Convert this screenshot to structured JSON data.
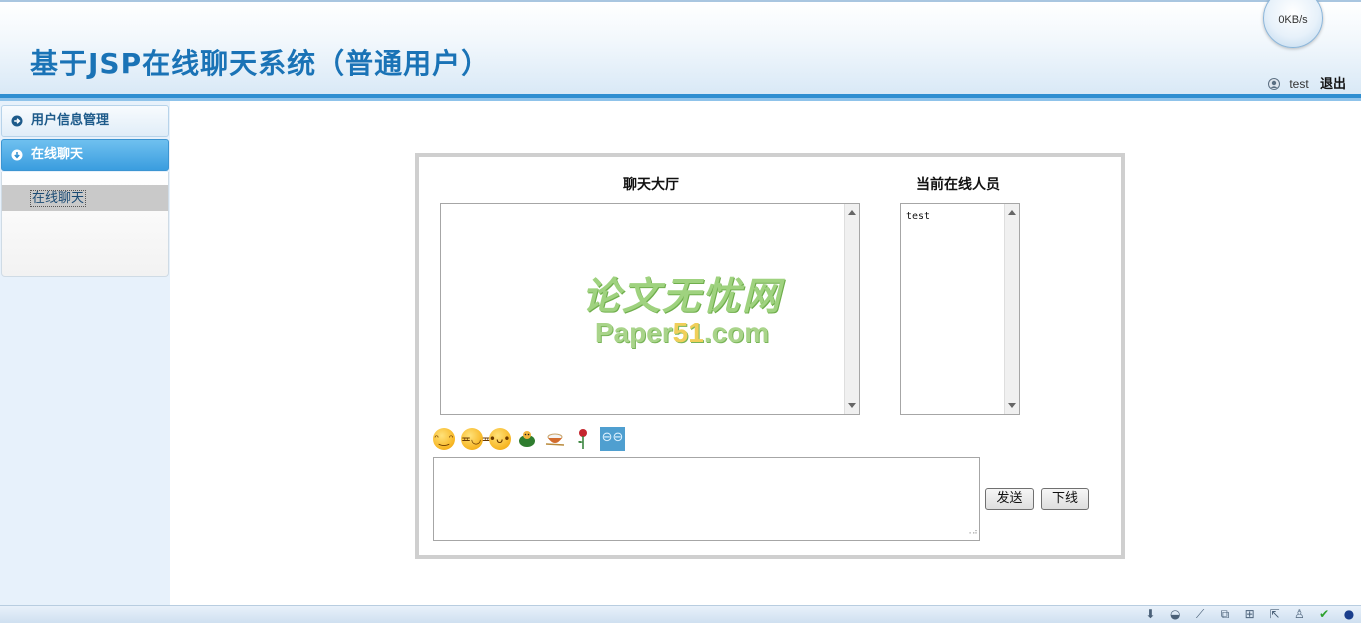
{
  "header": {
    "title": "基于JSP在线聊天系统（普通用户）",
    "speed": "0KB/s",
    "user_icon": "user-avatar-icon",
    "username": "test",
    "logout_label": "退出"
  },
  "sidebar": {
    "menus": [
      {
        "label": "用户信息管理",
        "icon": "arrow-right-circle-icon",
        "expanded": false
      },
      {
        "label": "在线聊天",
        "icon": "arrow-down-circle-icon",
        "expanded": true
      }
    ],
    "submenu_items": [
      {
        "label": "在线聊天",
        "selected": true
      }
    ]
  },
  "chat": {
    "hall_title": "聊天大厅",
    "online_title": "当前在线人员",
    "online_users": [
      "test"
    ],
    "watermark_line1": "论文无忧网",
    "watermark_line2_a": "Paper",
    "watermark_line2_b": "51",
    "watermark_line2_c": ".com",
    "emoticons": [
      "tongue-face-icon",
      "grin-face-icon",
      "shy-face-icon",
      "turtle-icon",
      "rice-bowl-icon",
      "rose-icon",
      "cool-square-icon"
    ],
    "message_value": "",
    "send_label": "发送",
    "offline_label": "下线"
  },
  "footer": {
    "tray_icons": [
      "download-icon",
      "mask-icon",
      "broom-icon",
      "window-icon",
      "medkit-icon",
      "export-icon",
      "person-icon",
      "check-icon",
      "globe-icon"
    ]
  },
  "colors": {
    "title": "#1a73b6",
    "header_line": "#2f8fd1",
    "sidebar_bg": "#e7f1fb",
    "active_menu": "#3a9ddf",
    "panel_border": "#cfcfcf"
  }
}
